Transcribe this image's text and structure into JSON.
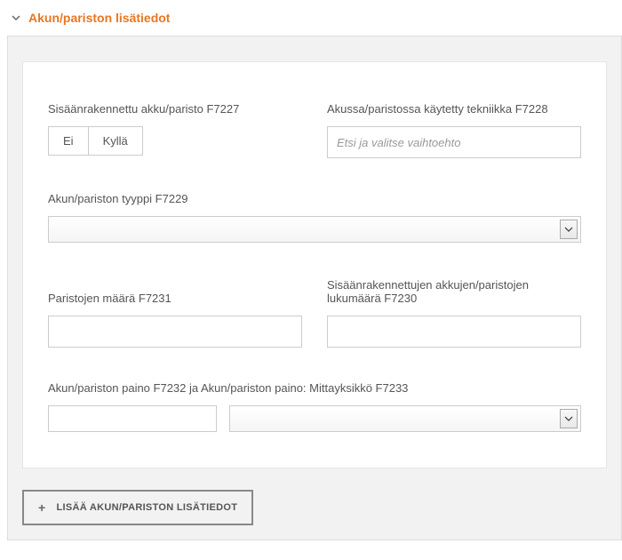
{
  "section": {
    "title": "Akun/pariston lisätiedot"
  },
  "fields": {
    "built_in": {
      "label": "Sisäänrakennettu akku/paristo F7227",
      "no": "Ei",
      "yes": "Kyllä"
    },
    "tech": {
      "label": "Akussa/paristossa käytetty tekniikka F7228",
      "placeholder": "Etsi ja valitse vaihtoehto"
    },
    "type": {
      "label": "Akun/pariston tyyppi F7229"
    },
    "count": {
      "label": "Paristojen määrä F7231"
    },
    "built_in_count": {
      "label": "Sisäänrakennettujen akkujen/paristojen lukumäärä F7230"
    },
    "weight": {
      "label": "Akun/pariston paino F7232 ja Akun/pariston paino: Mittayksikkö F7233"
    }
  },
  "actions": {
    "add": "LISÄÄ AKUN/PARISTON LISÄTIEDOT"
  }
}
